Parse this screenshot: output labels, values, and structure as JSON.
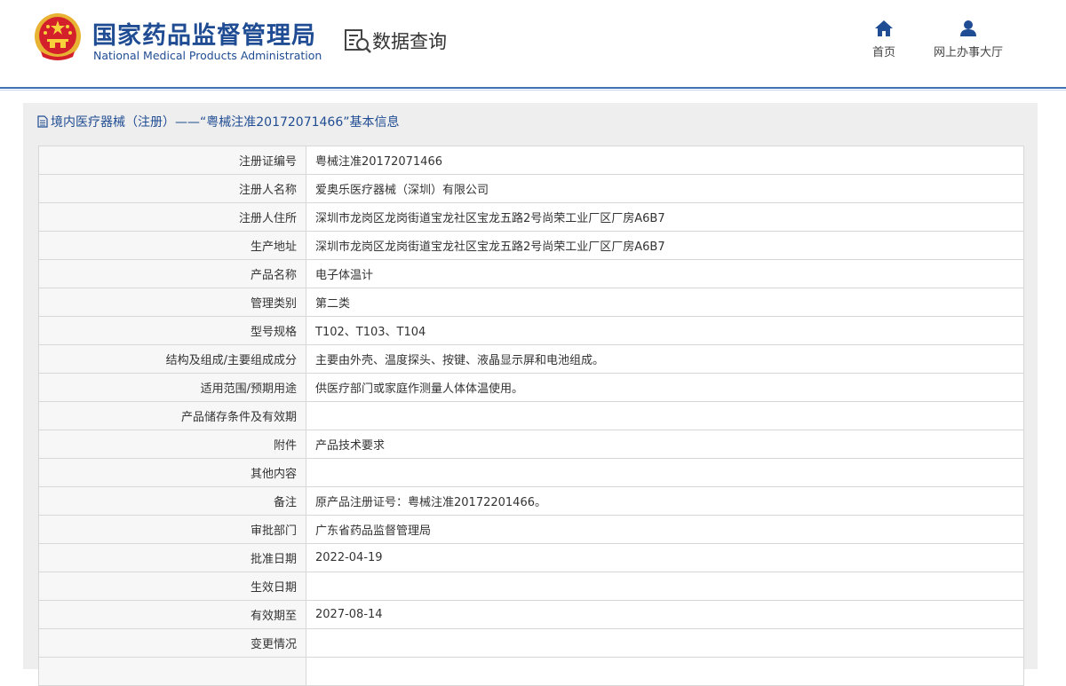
{
  "header": {
    "title_cn": "国家药品监督管理局",
    "title_en": "National Medical Products Administration",
    "section": "数据查询",
    "nav": [
      {
        "label": "首页",
        "icon": "home-icon"
      },
      {
        "label": "网上办事大厅",
        "icon": "user-icon"
      }
    ]
  },
  "panel": {
    "title": "境内医疗器械（注册）——“粤械注准20172071466”基本信息"
  },
  "rows": [
    {
      "key": "注册证编号",
      "value": "粤械注准20172071466"
    },
    {
      "key": "注册人名称",
      "value": "爱奥乐医疗器械（深圳）有限公司"
    },
    {
      "key": "注册人住所",
      "value": "深圳市龙岗区龙岗街道宝龙社区宝龙五路2号尚荣工业厂区厂房A6B7"
    },
    {
      "key": "生产地址",
      "value": "深圳市龙岗区龙岗街道宝龙社区宝龙五路2号尚荣工业厂区厂房A6B7"
    },
    {
      "key": "产品名称",
      "value": "电子体温计"
    },
    {
      "key": "管理类别",
      "value": "第二类"
    },
    {
      "key": "型号规格",
      "value": "T102、T103、T104"
    },
    {
      "key": "结构及组成/主要组成成分",
      "value": "主要由外壳、温度探头、按键、液晶显示屏和电池组成。"
    },
    {
      "key": "适用范围/预期用途",
      "value": "供医疗部门或家庭作测量人体体温使用。"
    },
    {
      "key": "产品储存条件及有效期",
      "value": ""
    },
    {
      "key": "附件",
      "value": "产品技术要求"
    },
    {
      "key": "其他内容",
      "value": ""
    },
    {
      "key": "备注",
      "value": "原产品注册证号：粤械注准20172201466。"
    },
    {
      "key": "审批部门",
      "value": "广东省药品监督管理局"
    },
    {
      "key": "批准日期",
      "value": "2022-04-19"
    },
    {
      "key": "生效日期",
      "value": ""
    },
    {
      "key": "有效期至",
      "value": "2027-08-14"
    },
    {
      "key": "变更情况",
      "value": ""
    },
    {
      "key": "",
      "value": ""
    }
  ],
  "colors": {
    "brand_blue": "#1f4c93",
    "emblem_red": "#d3202a",
    "emblem_gold": "#f2c43a",
    "header_rule": "#3f6fb5"
  }
}
